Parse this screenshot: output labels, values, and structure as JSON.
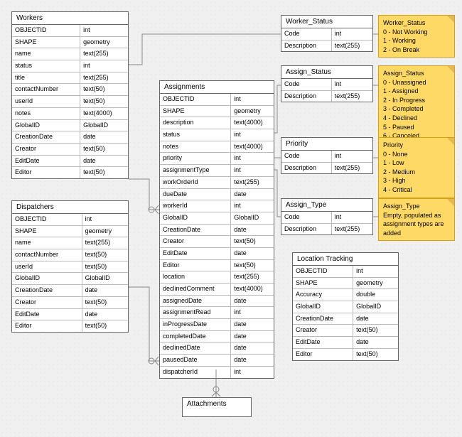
{
  "entities": {
    "workers": {
      "title": "Workers",
      "rows": [
        [
          "OBJECTID",
          "int"
        ],
        [
          "SHAPE",
          "geometry"
        ],
        [
          "name",
          "text(255)"
        ],
        [
          "status",
          "int"
        ],
        [
          "title",
          "text(255)"
        ],
        [
          "contactNumber",
          "text(50)"
        ],
        [
          "userId",
          "text(50)"
        ],
        [
          "notes",
          "text(4000)"
        ],
        [
          "GlobalID",
          "GlobalID"
        ],
        [
          "CreationDate",
          "date"
        ],
        [
          "Creator",
          "text(50)"
        ],
        [
          "EditDate",
          "date"
        ],
        [
          "Editor",
          "text(50)"
        ]
      ]
    },
    "dispatchers": {
      "title": "Dispatchers",
      "rows": [
        [
          "OBJECTID",
          "int"
        ],
        [
          "SHAPE",
          "geometry"
        ],
        [
          "name",
          "text(255)"
        ],
        [
          "contactNumber",
          "text(50)"
        ],
        [
          "userId",
          "text(50)"
        ],
        [
          "GlobalID",
          "GlobalID"
        ],
        [
          "CreationDate",
          "date"
        ],
        [
          "Creator",
          "text(50)"
        ],
        [
          "EditDate",
          "date"
        ],
        [
          "Editor",
          "text(50)"
        ]
      ]
    },
    "assignments": {
      "title": "Assignments",
      "rows": [
        [
          "OBJECTID",
          "int"
        ],
        [
          "SHAPE",
          "geometry"
        ],
        [
          "description",
          "text(4000)"
        ],
        [
          "status",
          "int"
        ],
        [
          "notes",
          "text(4000)"
        ],
        [
          "priority",
          "int"
        ],
        [
          "assignmentType",
          "int"
        ],
        [
          "workOrderId",
          "text(255)"
        ],
        [
          "dueDate",
          "date"
        ],
        [
          "workerId",
          "int"
        ],
        [
          "GlobalID",
          "GlobalID"
        ],
        [
          "CreationDate",
          "date"
        ],
        [
          "Creator",
          "text(50)"
        ],
        [
          "EditDate",
          "date"
        ],
        [
          "Editor",
          "text(50)"
        ],
        [
          "location",
          "text(255)"
        ],
        [
          "declinedComment",
          "text(4000)"
        ],
        [
          "assignedDate",
          "date"
        ],
        [
          "assignmentRead",
          "int"
        ],
        [
          "inProgressDate",
          "date"
        ],
        [
          "completedDate",
          "date"
        ],
        [
          "declinedDate",
          "date"
        ],
        [
          "pausedDate",
          "date"
        ],
        [
          "dispatcherId",
          "int"
        ]
      ]
    },
    "worker_status": {
      "title": "Worker_Status",
      "rows": [
        [
          "Code",
          "int"
        ],
        [
          "Description",
          "text(255)"
        ]
      ]
    },
    "assign_status": {
      "title": "Assign_Status",
      "rows": [
        [
          "Code",
          "int"
        ],
        [
          "Description",
          "text(255)"
        ]
      ]
    },
    "priority": {
      "title": "Priority",
      "rows": [
        [
          "Code",
          "int"
        ],
        [
          "Description",
          "text(255)"
        ]
      ]
    },
    "assign_type": {
      "title": "Assign_Type",
      "rows": [
        [
          "Code",
          "int"
        ],
        [
          "Description",
          "text(255)"
        ]
      ]
    },
    "location_tracking": {
      "title": "Location Tracking",
      "rows": [
        [
          "OBJECTID",
          "int"
        ],
        [
          "SHAPE",
          "geometry"
        ],
        [
          "Accuracy",
          "double"
        ],
        [
          "GlobalID",
          "GlobalID"
        ],
        [
          "CreationDate",
          "date"
        ],
        [
          "Creator",
          "text(50)"
        ],
        [
          "EditDate",
          "date"
        ],
        [
          "Editor",
          "text(50)"
        ]
      ]
    },
    "attachments": {
      "title": "Attachments",
      "rows": []
    }
  },
  "notes": {
    "worker_status": {
      "title": "Worker_Status",
      "lines": [
        "0 - Not Working",
        "1 - Working",
        "2 - On Break"
      ]
    },
    "assign_status": {
      "title": "Assign_Status",
      "lines": [
        "0 - Unassigned",
        "1 - Assigned",
        "2 - In Progress",
        "3 - Completed",
        "4 - Declined",
        "5 - Paused",
        "6 - Canceled"
      ]
    },
    "priority": {
      "title": "Priority",
      "lines": [
        "0 - None",
        "1 - Low",
        "2 - Medium",
        "3 - High",
        "4 - Critical"
      ]
    },
    "assign_type": {
      "title": "Assign_Type",
      "lines": [
        "Empty, populated as assignment types are added"
      ]
    }
  }
}
